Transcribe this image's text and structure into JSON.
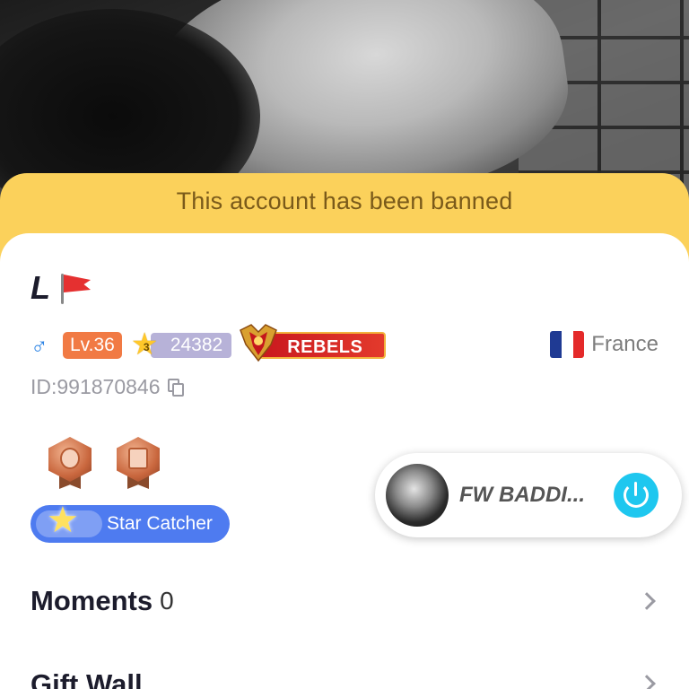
{
  "banner": {
    "text": "This account has been banned"
  },
  "profile": {
    "username": "L",
    "gender_icon": "male-icon",
    "level": "Lv.36",
    "star_points": "24382",
    "star_rank": "3",
    "family": "REBELS",
    "country": "France",
    "id": "ID:991870846"
  },
  "medals": [
    "medal-microphone-icon",
    "medal-gift-icon"
  ],
  "title_badge": {
    "label": "Star Catcher"
  },
  "room": {
    "name": "FW BADDI..."
  },
  "sections": [
    {
      "title": "Moments",
      "count": "0"
    },
    {
      "title": "Gift Wall",
      "count": ""
    }
  ],
  "colors": {
    "banner": "#fbd15b",
    "level": "#f17a44",
    "star_catcher": "#4e7bf0",
    "power": "#1ec7ef",
    "family": "#c9181e"
  }
}
